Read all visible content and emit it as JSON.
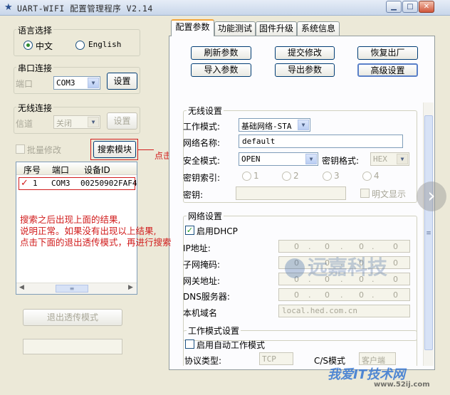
{
  "window": {
    "title": "UART-WIFI 配置管理程序 V2.14"
  },
  "lang": {
    "group": "语言选择",
    "zh": "中文",
    "en": "English"
  },
  "serial": {
    "group": "串口连接",
    "port_label": "端口",
    "port_value": "COM3",
    "set_button": "设置"
  },
  "wireless": {
    "group": "无线连接",
    "channel_label": "信道",
    "channel_value": "关闭",
    "set_button": "设置"
  },
  "batch": {
    "label": "批量修改",
    "search_button": "搜索模块",
    "click_hint": "点击"
  },
  "results": {
    "headers": [
      "序号",
      "端口",
      "设备ID"
    ],
    "rows": [
      {
        "index": "1",
        "port": "COM3",
        "id": "00250902FAF4"
      }
    ]
  },
  "annotation": {
    "line1": "搜索之后出现上面的结果,",
    "line2": "说明正常。如果没有出现以上结果,",
    "line3": "点击下面的退出透传模式，再进行搜索"
  },
  "exit_button": "退出透传模式",
  "tabs": [
    "配置参数",
    "功能测试",
    "固件升级",
    "系统信息"
  ],
  "actions": {
    "refresh": "刷新参数",
    "submit": "提交修改",
    "factory": "恢复出厂",
    "import": "导入参数",
    "export": "导出参数",
    "advanced": "高级设置"
  },
  "wifi": {
    "group": "无线设置",
    "mode_label": "工作模式:",
    "mode_value": "基础网络-STA",
    "ssid_label": "网络名称:",
    "ssid_value": "default",
    "security_label": "安全模式:",
    "security_value": "OPEN",
    "keyformat_label": "密钥格式:",
    "keyformat_value": "HEX",
    "keyindex_label": "密钥索引:",
    "keyindex_options": [
      "1",
      "2",
      "3",
      "4"
    ],
    "key_label": "密钥:",
    "plaintext_label": "明文显示"
  },
  "net": {
    "group": "网络设置",
    "dhcp_label": "启用DHCP",
    "ip_label": "IP地址:",
    "mask_label": "子网掩码:",
    "gateway_label": "网关地址:",
    "dns_label": "DNS服务器:",
    "domain_label": "本机域名",
    "ip_value": [
      "0",
      "0",
      "0",
      "0"
    ],
    "mask_value": [
      "0",
      "0",
      "0",
      "0"
    ],
    "gateway_value": [
      "0",
      "0",
      "0",
      "0"
    ],
    "dns_value": [
      "0",
      "0",
      "0",
      "0"
    ],
    "domain_value": "local.hed.com.cn"
  },
  "workmode": {
    "group": "工作模式设置",
    "auto_label": "启用自动工作模式",
    "protocol_label": "协议类型:",
    "protocol_value": "TCP",
    "cs_label": "C/S模式",
    "cs_value": "客户端"
  },
  "watermark": {
    "a": "远嘉科技",
    "b": "我爱IT技术网",
    "c": "www.52ij.com"
  },
  "colors": {
    "accent": "#d11c1c",
    "tab_highlight": "#f2a53b",
    "check": "#21a121"
  }
}
